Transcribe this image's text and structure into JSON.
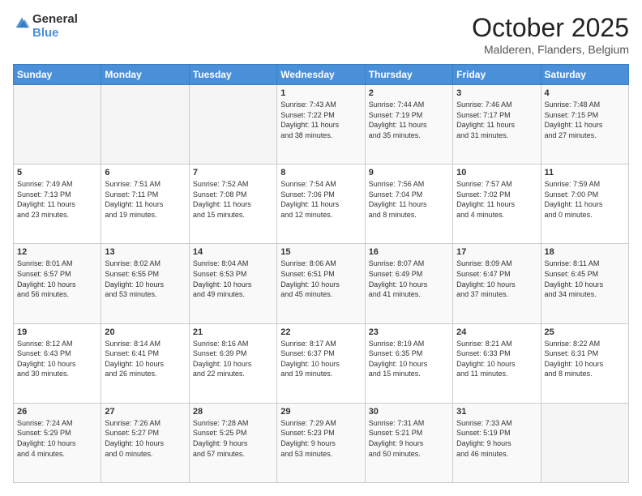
{
  "header": {
    "logo_line1": "General",
    "logo_line2": "Blue",
    "title": "October 2025",
    "subtitle": "Malderen, Flanders, Belgium"
  },
  "weekdays": [
    "Sunday",
    "Monday",
    "Tuesday",
    "Wednesday",
    "Thursday",
    "Friday",
    "Saturday"
  ],
  "weeks": [
    [
      {
        "day": "",
        "info": ""
      },
      {
        "day": "",
        "info": ""
      },
      {
        "day": "",
        "info": ""
      },
      {
        "day": "1",
        "info": "Sunrise: 7:43 AM\nSunset: 7:22 PM\nDaylight: 11 hours\nand 38 minutes."
      },
      {
        "day": "2",
        "info": "Sunrise: 7:44 AM\nSunset: 7:19 PM\nDaylight: 11 hours\nand 35 minutes."
      },
      {
        "day": "3",
        "info": "Sunrise: 7:46 AM\nSunset: 7:17 PM\nDaylight: 11 hours\nand 31 minutes."
      },
      {
        "day": "4",
        "info": "Sunrise: 7:48 AM\nSunset: 7:15 PM\nDaylight: 11 hours\nand 27 minutes."
      }
    ],
    [
      {
        "day": "5",
        "info": "Sunrise: 7:49 AM\nSunset: 7:13 PM\nDaylight: 11 hours\nand 23 minutes."
      },
      {
        "day": "6",
        "info": "Sunrise: 7:51 AM\nSunset: 7:11 PM\nDaylight: 11 hours\nand 19 minutes."
      },
      {
        "day": "7",
        "info": "Sunrise: 7:52 AM\nSunset: 7:08 PM\nDaylight: 11 hours\nand 15 minutes."
      },
      {
        "day": "8",
        "info": "Sunrise: 7:54 AM\nSunset: 7:06 PM\nDaylight: 11 hours\nand 12 minutes."
      },
      {
        "day": "9",
        "info": "Sunrise: 7:56 AM\nSunset: 7:04 PM\nDaylight: 11 hours\nand 8 minutes."
      },
      {
        "day": "10",
        "info": "Sunrise: 7:57 AM\nSunset: 7:02 PM\nDaylight: 11 hours\nand 4 minutes."
      },
      {
        "day": "11",
        "info": "Sunrise: 7:59 AM\nSunset: 7:00 PM\nDaylight: 11 hours\nand 0 minutes."
      }
    ],
    [
      {
        "day": "12",
        "info": "Sunrise: 8:01 AM\nSunset: 6:57 PM\nDaylight: 10 hours\nand 56 minutes."
      },
      {
        "day": "13",
        "info": "Sunrise: 8:02 AM\nSunset: 6:55 PM\nDaylight: 10 hours\nand 53 minutes."
      },
      {
        "day": "14",
        "info": "Sunrise: 8:04 AM\nSunset: 6:53 PM\nDaylight: 10 hours\nand 49 minutes."
      },
      {
        "day": "15",
        "info": "Sunrise: 8:06 AM\nSunset: 6:51 PM\nDaylight: 10 hours\nand 45 minutes."
      },
      {
        "day": "16",
        "info": "Sunrise: 8:07 AM\nSunset: 6:49 PM\nDaylight: 10 hours\nand 41 minutes."
      },
      {
        "day": "17",
        "info": "Sunrise: 8:09 AM\nSunset: 6:47 PM\nDaylight: 10 hours\nand 37 minutes."
      },
      {
        "day": "18",
        "info": "Sunrise: 8:11 AM\nSunset: 6:45 PM\nDaylight: 10 hours\nand 34 minutes."
      }
    ],
    [
      {
        "day": "19",
        "info": "Sunrise: 8:12 AM\nSunset: 6:43 PM\nDaylight: 10 hours\nand 30 minutes."
      },
      {
        "day": "20",
        "info": "Sunrise: 8:14 AM\nSunset: 6:41 PM\nDaylight: 10 hours\nand 26 minutes."
      },
      {
        "day": "21",
        "info": "Sunrise: 8:16 AM\nSunset: 6:39 PM\nDaylight: 10 hours\nand 22 minutes."
      },
      {
        "day": "22",
        "info": "Sunrise: 8:17 AM\nSunset: 6:37 PM\nDaylight: 10 hours\nand 19 minutes."
      },
      {
        "day": "23",
        "info": "Sunrise: 8:19 AM\nSunset: 6:35 PM\nDaylight: 10 hours\nand 15 minutes."
      },
      {
        "day": "24",
        "info": "Sunrise: 8:21 AM\nSunset: 6:33 PM\nDaylight: 10 hours\nand 11 minutes."
      },
      {
        "day": "25",
        "info": "Sunrise: 8:22 AM\nSunset: 6:31 PM\nDaylight: 10 hours\nand 8 minutes."
      }
    ],
    [
      {
        "day": "26",
        "info": "Sunrise: 7:24 AM\nSunset: 5:29 PM\nDaylight: 10 hours\nand 4 minutes."
      },
      {
        "day": "27",
        "info": "Sunrise: 7:26 AM\nSunset: 5:27 PM\nDaylight: 10 hours\nand 0 minutes."
      },
      {
        "day": "28",
        "info": "Sunrise: 7:28 AM\nSunset: 5:25 PM\nDaylight: 9 hours\nand 57 minutes."
      },
      {
        "day": "29",
        "info": "Sunrise: 7:29 AM\nSunset: 5:23 PM\nDaylight: 9 hours\nand 53 minutes."
      },
      {
        "day": "30",
        "info": "Sunrise: 7:31 AM\nSunset: 5:21 PM\nDaylight: 9 hours\nand 50 minutes."
      },
      {
        "day": "31",
        "info": "Sunrise: 7:33 AM\nSunset: 5:19 PM\nDaylight: 9 hours\nand 46 minutes."
      },
      {
        "day": "",
        "info": ""
      }
    ]
  ]
}
